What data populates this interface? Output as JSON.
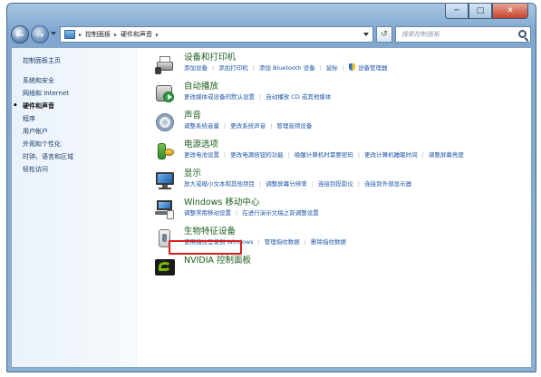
{
  "window": {
    "caption": {
      "minimize": "─",
      "maximize": "□",
      "close": "✕"
    }
  },
  "toolbar": {
    "back_icon": "back-arrow-icon",
    "forward_icon": "forward-arrow-icon",
    "breadcrumb": [
      "控制面板",
      "硬件和声音"
    ],
    "search_placeholder": "搜索控制面板"
  },
  "sidebar": {
    "items": [
      {
        "label": "控制面板主页"
      },
      {
        "label": "系统和安全"
      },
      {
        "label": "网络和 Internet"
      },
      {
        "label": "硬件和声音",
        "active": true
      },
      {
        "label": "程序"
      },
      {
        "label": "用户帐户"
      },
      {
        "label": "外观和个性化"
      },
      {
        "label": "时钟、语言和区域"
      },
      {
        "label": "轻松访问"
      }
    ]
  },
  "categories": [
    {
      "title": "设备和打印机",
      "icon": "printer-icon",
      "links": [
        "添加设备",
        "添加打印机",
        "添加 Bluetooth 设备",
        "鼠标",
        "设备管理器"
      ]
    },
    {
      "title": "自动播放",
      "icon": "autoplay-icon",
      "links": [
        "更改媒体或设备的默认设置",
        "自动播放 CD 或其他媒体"
      ]
    },
    {
      "title": "声音",
      "icon": "speaker-icon",
      "links": [
        "调整系统音量",
        "更改系统声音",
        "管理音频设备"
      ]
    },
    {
      "title": "电源选项",
      "icon": "power-icon",
      "links": [
        "更改电池设置",
        "更改电源按钮的功能",
        "唤醒计算机时需要密码",
        "更改计算机睡眠时间",
        "调整屏幕亮度"
      ]
    },
    {
      "title": "显示",
      "icon": "monitor-icon",
      "links": [
        "放大或缩小文本和其他项目",
        "调整屏幕分辨率",
        "连接到投影仪",
        "连接到外部显示器"
      ]
    },
    {
      "title": "Windows 移动中心",
      "icon": "laptop-icon",
      "links": [
        "调整常用移动设置",
        "在进行演示文稿之前调整设置"
      ]
    },
    {
      "title": "生物特征设备",
      "icon": "fingerprint-reader-icon",
      "highlighted": true,
      "links": [
        "使用指纹登录到 Windows",
        "管理指纹数据",
        "删除指纹数据"
      ]
    },
    {
      "title": "NVIDIA 控制面板",
      "icon": "nvidia-icon",
      "links": []
    }
  ],
  "colors": {
    "highlight": "#d81e1e",
    "link": "#1e55a8",
    "title": "#1b5e1b",
    "chrome": "#8bb1d6"
  }
}
